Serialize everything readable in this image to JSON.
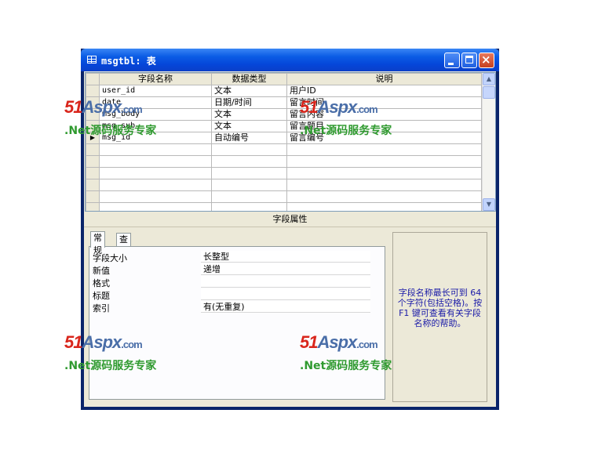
{
  "window": {
    "title": "msgtbl: 表",
    "min_label": "_",
    "max_label": "□",
    "close_label": "×"
  },
  "grid": {
    "headers": [
      "字段名称",
      "数据类型",
      "说明"
    ],
    "rows": [
      {
        "selector": "",
        "name": "user_id",
        "type": "文本",
        "desc": "用户ID"
      },
      {
        "selector": "",
        "name": "date",
        "type": "日期/时间",
        "desc": "留言时间"
      },
      {
        "selector": "",
        "name": "msg_body",
        "type": "文本",
        "desc": "留言内容"
      },
      {
        "selector": "",
        "name": "msg_sub",
        "type": "文本",
        "desc": "留言题目"
      },
      {
        "selector": "▶",
        "name": "msg_id",
        "type": "自动编号",
        "desc": "留言编号"
      },
      {
        "selector": "",
        "name": "",
        "type": "",
        "desc": ""
      },
      {
        "selector": "",
        "name": "",
        "type": "",
        "desc": ""
      },
      {
        "selector": "",
        "name": "",
        "type": "",
        "desc": ""
      },
      {
        "selector": "",
        "name": "",
        "type": "",
        "desc": ""
      },
      {
        "selector": "",
        "name": "",
        "type": "",
        "desc": ""
      },
      {
        "selector": "",
        "name": "",
        "type": "",
        "desc": ""
      }
    ],
    "scroll_up": "▲",
    "scroll_down": "▼"
  },
  "properties": {
    "title": "字段属性",
    "tabs": [
      "常规",
      "查阅"
    ],
    "rows": [
      {
        "label": "字段大小",
        "value": "长整型"
      },
      {
        "label": "新值",
        "value": "递增"
      },
      {
        "label": "格式",
        "value": ""
      },
      {
        "label": "标题",
        "value": ""
      },
      {
        "label": "索引",
        "value": "有(无重复)"
      }
    ],
    "help_text": "字段名称最长可到 64 个字符(包括空格)。按 F1 键可查看有关字段名称的帮助。"
  },
  "watermark": {
    "logo_51": "51",
    "logo_aspx": "Aspx",
    "logo_com": ".com",
    "slogan": ".Net源码服务专家"
  },
  "colors": {
    "title_blue": "#0546d9",
    "help_text": "#1a1aa8",
    "watermark_red": "#d9261c",
    "watermark_green": "#2f9a2f"
  }
}
